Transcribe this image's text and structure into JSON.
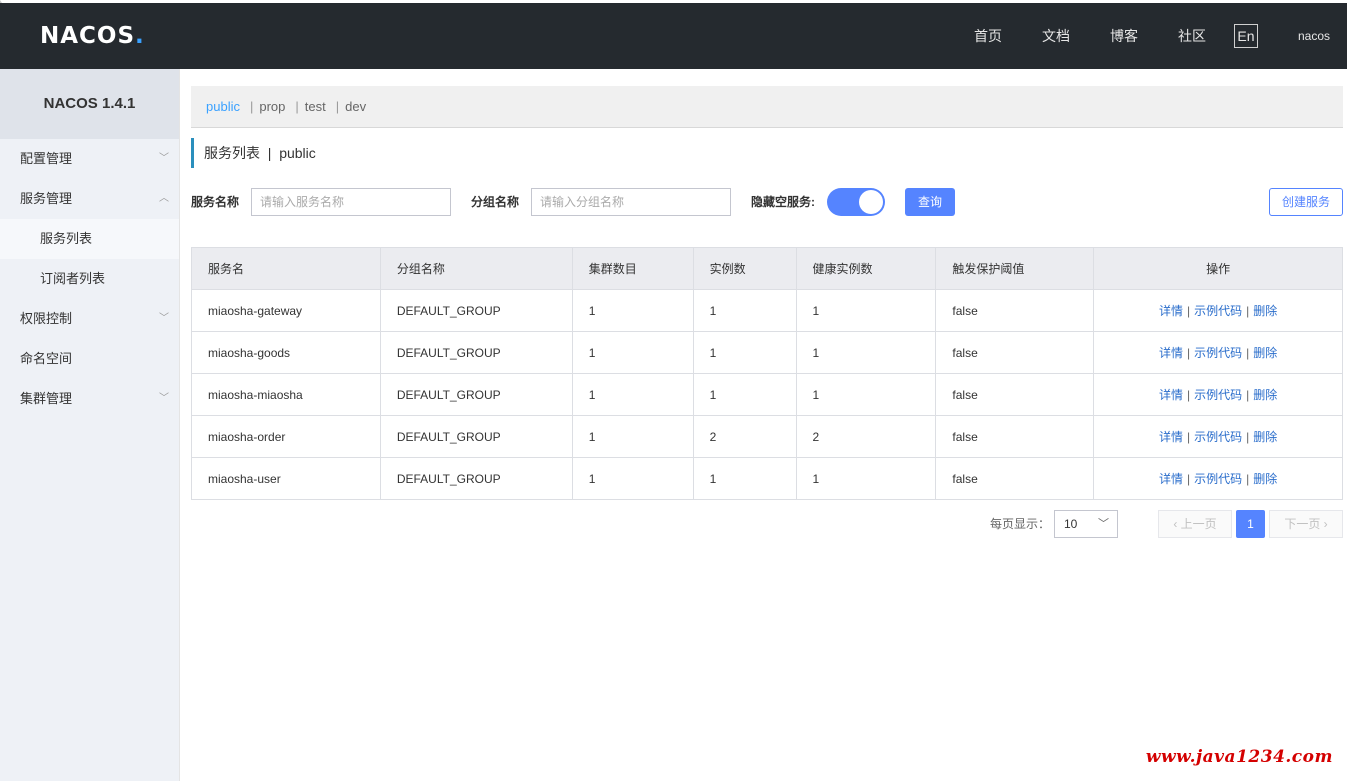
{
  "header": {
    "logo": "NACOS",
    "logo_dot": ".",
    "nav": [
      "首页",
      "文档",
      "博客",
      "社区"
    ],
    "lang": "En",
    "user": "nacos"
  },
  "sidebar": {
    "version": "NACOS 1.4.1",
    "items": [
      {
        "label": "配置管理"
      },
      {
        "label": "服务管理"
      },
      {
        "label": "服务列表"
      },
      {
        "label": "订阅者列表"
      },
      {
        "label": "权限控制"
      },
      {
        "label": "命名空间"
      },
      {
        "label": "集群管理"
      }
    ]
  },
  "namespaces": [
    "public",
    "prop",
    "test",
    "dev"
  ],
  "page": {
    "title": "服务列表",
    "title_sep": "|",
    "namespace": "public"
  },
  "filters": {
    "service_label": "服务名称",
    "service_placeholder": "请输入服务名称",
    "group_label": "分组名称",
    "group_placeholder": "请输入分组名称",
    "hide_empty_label": "隐藏空服务:",
    "query_button": "查询",
    "create_button": "创建服务"
  },
  "table": {
    "headers": [
      "服务名",
      "分组名称",
      "集群数目",
      "实例数",
      "健康实例数",
      "触发保护阈值",
      "操作"
    ],
    "rows": [
      [
        "miaosha-gateway",
        "DEFAULT_GROUP",
        "1",
        "1",
        "1",
        "false"
      ],
      [
        "miaosha-goods",
        "DEFAULT_GROUP",
        "1",
        "1",
        "1",
        "false"
      ],
      [
        "miaosha-miaosha",
        "DEFAULT_GROUP",
        "1",
        "1",
        "1",
        "false"
      ],
      [
        "miaosha-order",
        "DEFAULT_GROUP",
        "1",
        "2",
        "2",
        "false"
      ],
      [
        "miaosha-user",
        "DEFAULT_GROUP",
        "1",
        "1",
        "1",
        "false"
      ]
    ],
    "actions": {
      "detail": "详情",
      "sample": "示例代码",
      "delete": "删除",
      "sep": "|"
    }
  },
  "pagination": {
    "page_size_label": "每页显示：",
    "page_size": "10",
    "prev": "上一页",
    "current": "1",
    "next": "下一页"
  },
  "watermark": "www.java1234.com"
}
